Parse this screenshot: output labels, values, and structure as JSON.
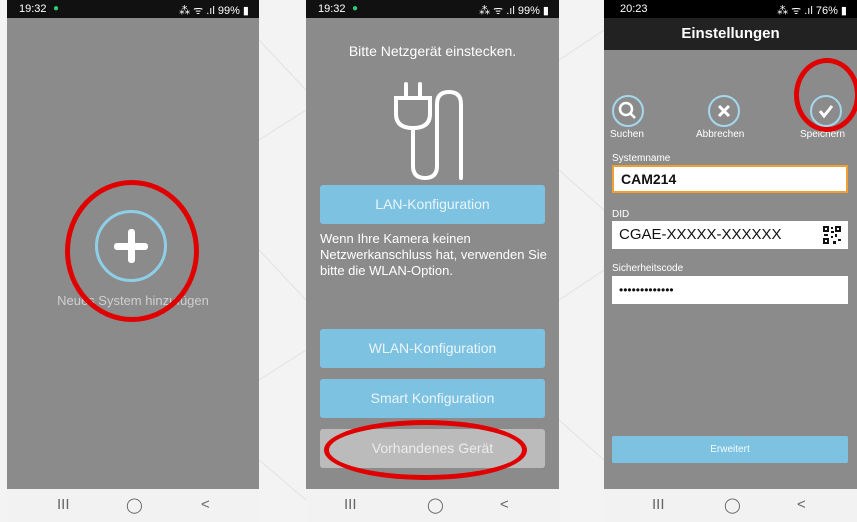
{
  "screens": [
    {
      "status": {
        "time": "19:32",
        "right": "⁂ ᯤ .ıl 99% ▮"
      },
      "add_label": "Neues System hinzufügen",
      "nav": {
        "recent": "III",
        "home": "◯",
        "back": "<"
      }
    },
    {
      "status": {
        "time": "19:32",
        "right": "⁂ ᯤ .ıl 99% ▮"
      },
      "title": "Bitte Netzgerät einstecken.",
      "lan_button": "LAN-Konfiguration",
      "info_text": "Wenn Ihre Kamera keinen Netzwerkanschluss hat, verwenden Sie bitte die WLAN-Option.",
      "wlan_button": "WLAN-Konfiguration",
      "smart_button": "Smart Konfiguration",
      "existing_button": "Vorhandenes Gerät",
      "nav": {
        "recent": "III",
        "home": "◯",
        "back": "<"
      }
    },
    {
      "status": {
        "time": "20:23",
        "right": "⁂ ᯤ .ıl 76% ▮"
      },
      "title": "Einstellungen",
      "toolbar": {
        "search": "Suchen",
        "cancel": "Abbrechen",
        "save": "Speichern"
      },
      "fields": {
        "name_label": "Systemname",
        "name_value": "CAM214",
        "did_label": "DID",
        "did_value": "CGAE-XXXXX-XXXXXX",
        "code_label": "Sicherheitscode",
        "code_value": "•••••••••••••"
      },
      "extended_button": "Erweitert",
      "nav": {
        "recent": "III",
        "home": "◯",
        "back": "<"
      }
    }
  ],
  "colors": {
    "accent": "#7ec2e2",
    "highlight": "#e00000",
    "screen_bg": "#8b8b8b",
    "input_focus": "#f0a030"
  }
}
